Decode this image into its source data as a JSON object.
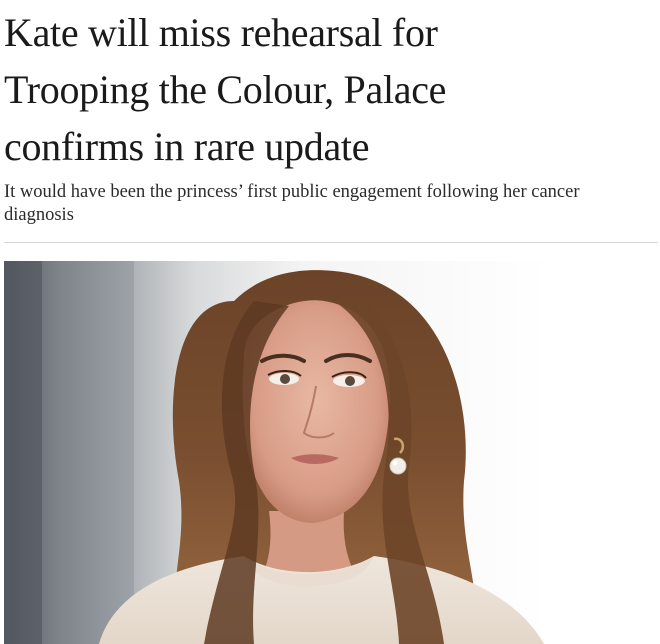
{
  "article": {
    "headline": "Kate will miss rehearsal for\nTrooping the Colour, Palace\nconfirms in rare update",
    "standfirst": "It would have been the princess’ first public engagement following her cancer\ndiagnosis"
  },
  "photo": {
    "subject": "portrait-photo"
  }
}
